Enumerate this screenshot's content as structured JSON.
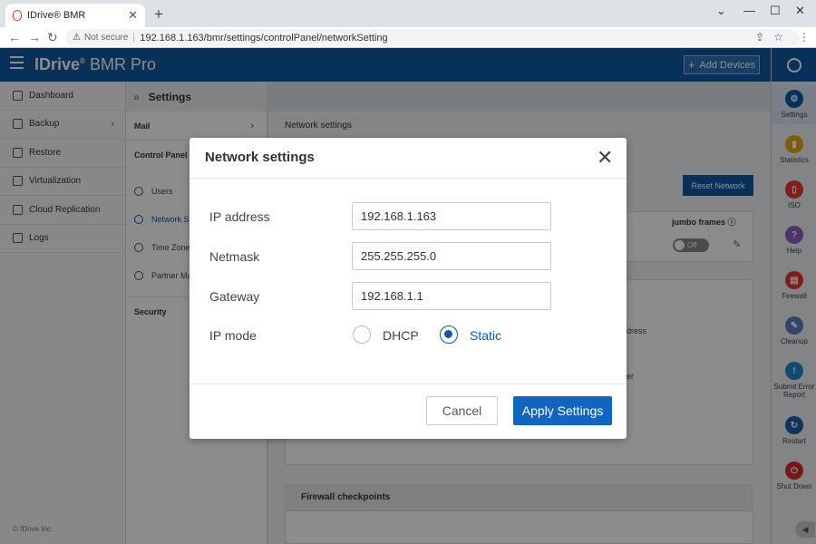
{
  "browser": {
    "tab_title": "IDrive® BMR",
    "security_label": "Not secure",
    "url": "192.168.1.163/bmr/settings/controlPanel/networkSetting"
  },
  "header": {
    "brand_name": "IDrive",
    "brand_sub": "BMR Pro",
    "add_devices_label": "Add Devices"
  },
  "sidebar": {
    "items": [
      {
        "label": "Dashboard",
        "icon": "dashboard-icon"
      },
      {
        "label": "Backup",
        "icon": "backup-icon"
      },
      {
        "label": "Restore",
        "icon": "restore-icon"
      },
      {
        "label": "Virtualization",
        "icon": "virtualization-icon"
      },
      {
        "label": "Cloud Replication",
        "icon": "cloud-icon"
      },
      {
        "label": "Logs",
        "icon": "logs-icon"
      }
    ],
    "copyright": "© IDrive Inc."
  },
  "settings": {
    "title": "Settings",
    "mail_label": "Mail",
    "control_panel_label": "Control Panel",
    "sub_items": [
      "Users",
      "Network S",
      "Time Zone",
      "Partner Ma"
    ],
    "security_label": "Security"
  },
  "main": {
    "section_title": "Network settings",
    "reset_label": "Reset Network",
    "jumbo_label": "jumbo frames",
    "toggle_label": "Off",
    "fragment_1": "dress",
    "fragment_2": "er",
    "firewall_title": "Firewall checkpoints"
  },
  "modal": {
    "title": "Network settings",
    "ip_label": "IP address",
    "ip_value": "192.168.1.163",
    "netmask_label": "Netmask",
    "netmask_value": "255.255.255.0",
    "gateway_label": "Gateway",
    "gateway_value": "192.168.1.1",
    "ipmode_label": "IP mode",
    "option_dhcp": "DHCP",
    "option_static": "Static",
    "selected_mode": "Static",
    "cancel_label": "Cancel",
    "apply_label": "Apply Settings"
  },
  "rail": {
    "items": [
      {
        "label": "Settings",
        "icon": "gear-icon",
        "color": "#0f5aa5"
      },
      {
        "label": "Statistics",
        "icon": "statistics-icon",
        "color": "#e6a817"
      },
      {
        "label": "ISO",
        "icon": "iso-icon",
        "color": "#e53935"
      },
      {
        "label": "Help",
        "icon": "help-icon",
        "color": "#8e5fc4"
      },
      {
        "label": "Firewall",
        "icon": "firewall-icon",
        "color": "#e53935"
      },
      {
        "label": "Cleanup",
        "icon": "cleanup-icon",
        "color": "#5a7fc4"
      },
      {
        "label": "Submit Error Report",
        "icon": "warning-icon",
        "color": "#1e88c8"
      },
      {
        "label": "Restart",
        "icon": "restart-icon",
        "color": "#1f5fa8"
      },
      {
        "label": "Shut Down",
        "icon": "power-icon",
        "color": "#d32f2f"
      }
    ]
  }
}
